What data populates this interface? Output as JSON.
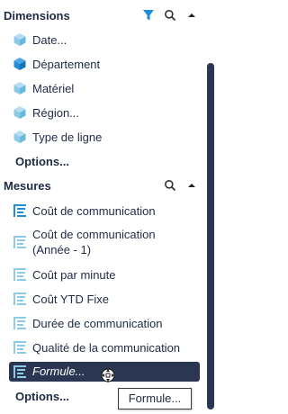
{
  "dimensions": {
    "title": "Dimensions",
    "items": [
      {
        "label": "Date...",
        "icon": "cube-light-icon"
      },
      {
        "label": "Département",
        "icon": "cube-dark-icon"
      },
      {
        "label": "Matériel",
        "icon": "cube-light-icon"
      },
      {
        "label": "Région...",
        "icon": "cube-light-icon"
      },
      {
        "label": "Type de ligne",
        "icon": "cube-light-icon"
      }
    ],
    "options_label": "Options..."
  },
  "mesures": {
    "title": "Mesures",
    "items": [
      {
        "label": "Coût de communication",
        "icon": "measure-dark-icon"
      },
      {
        "label": "Coût de communication (Année - 1)",
        "icon": "measure-light-icon"
      },
      {
        "label": "Coût par minute",
        "icon": "measure-light-icon"
      },
      {
        "label": "Coût YTD Fixe",
        "icon": "measure-light-icon"
      },
      {
        "label": "Durée de communication",
        "icon": "measure-light-icon"
      },
      {
        "label": "Qualité de la communication",
        "icon": "measure-light-icon"
      },
      {
        "label": "Formule...",
        "icon": "measure-light-icon",
        "selected": true
      }
    ],
    "options_label": "Options..."
  },
  "tooltip": {
    "text": "Formule..."
  },
  "colors": {
    "accent": "#2b3652",
    "filter": "#1e8fd6",
    "cube_light": "#8ccbe8",
    "cube_dark": "#1e8fd6"
  }
}
